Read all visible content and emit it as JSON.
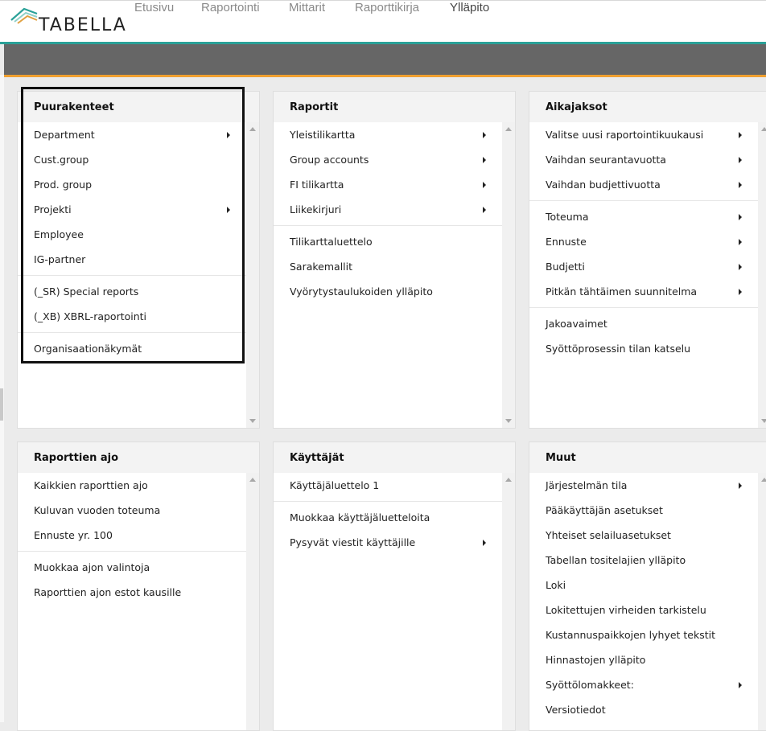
{
  "app": {
    "logo_text": "TABELLA"
  },
  "nav": [
    {
      "label": "Etusivu"
    },
    {
      "label": "Raportointi"
    },
    {
      "label": "Mittarit"
    },
    {
      "label": "Raporttikirja"
    },
    {
      "label": "Ylläpito",
      "active": true
    }
  ],
  "colors": {
    "accent_teal": "#2aa198",
    "accent_orange": "#f0a030",
    "header_bar": "#666666"
  },
  "panels": [
    {
      "title": "Puurakenteet",
      "groups": [
        [
          {
            "label": "Department",
            "submenu": true
          },
          {
            "label": "Cust.group"
          },
          {
            "label": "Prod. group"
          },
          {
            "label": "Projekti",
            "submenu": true
          },
          {
            "label": "Employee"
          },
          {
            "label": "IG-partner"
          }
        ],
        [
          {
            "label": "(_SR) Special reports"
          },
          {
            "label": "(_XB) XBRL-raportointi"
          }
        ],
        [
          {
            "label": "Organisaationäkymät"
          }
        ]
      ]
    },
    {
      "title": "Raportit",
      "groups": [
        [
          {
            "label": "Yleistilikartta",
            "submenu": true
          },
          {
            "label": "Group accounts",
            "submenu": true
          },
          {
            "label": "FI tilikartta",
            "submenu": true
          },
          {
            "label": "Liikekirjuri",
            "submenu": true
          }
        ],
        [
          {
            "label": "Tilikarttaluettelo"
          },
          {
            "label": "Sarakemallit"
          },
          {
            "label": "Vyörytystaulukoiden ylläpito"
          }
        ]
      ]
    },
    {
      "title": "Aikajaksot",
      "groups": [
        [
          {
            "label": "Valitse uusi raportointikuukausi",
            "submenu": true
          },
          {
            "label": "Vaihdan seurantavuotta",
            "submenu": true
          },
          {
            "label": "Vaihdan budjettivuotta",
            "submenu": true
          }
        ],
        [
          {
            "label": "Toteuma",
            "submenu": true
          },
          {
            "label": "Ennuste",
            "submenu": true
          },
          {
            "label": "Budjetti",
            "submenu": true
          },
          {
            "label": "Pitkän tähtäimen suunnitelma",
            "submenu": true
          }
        ],
        [
          {
            "label": "Jakoavaimet"
          },
          {
            "label": "Syöttöprosessin tilan katselu"
          }
        ]
      ]
    },
    {
      "title": "Raporttien ajo",
      "groups": [
        [
          {
            "label": "Kaikkien raporttien ajo"
          },
          {
            "label": "Kuluvan vuoden toteuma"
          },
          {
            "label": "Ennuste yr. 100"
          }
        ],
        [
          {
            "label": "Muokkaa ajon valintoja"
          },
          {
            "label": "Raporttien ajon estot kausille"
          }
        ]
      ]
    },
    {
      "title": "Käyttäjät",
      "groups": [
        [
          {
            "label": "Käyttäjäluettelo 1"
          }
        ],
        [
          {
            "label": "Muokkaa käyttäjäluetteloita"
          },
          {
            "label": "Pysyvät viestit käyttäjille",
            "submenu": true
          }
        ]
      ]
    },
    {
      "title": "Muut",
      "groups": [
        [
          {
            "label": "Järjestelmän tila",
            "submenu": true
          },
          {
            "label": "Pääkäyttäjän asetukset"
          },
          {
            "label": "Yhteiset selailuasetukset"
          },
          {
            "label": "Tabellan tositelajien ylläpito"
          },
          {
            "label": "Loki"
          },
          {
            "label": "Lokitettujen virheiden tarkistelu"
          },
          {
            "label": "Kustannuspaikkojen lyhyet tekstit"
          },
          {
            "label": "Hinnastojen ylläpito"
          },
          {
            "label": "Syöttölomakkeet:",
            "submenu": true
          },
          {
            "label": "Versiotiedot"
          }
        ]
      ]
    }
  ]
}
